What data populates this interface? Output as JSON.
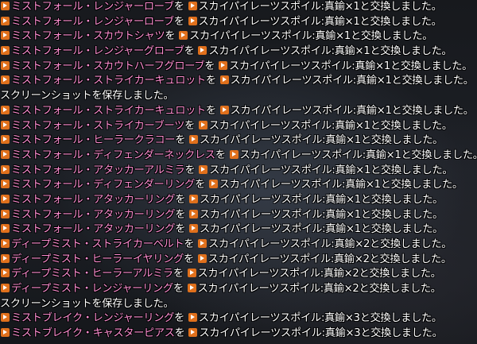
{
  "chat_log": {
    "lines": [
      {
        "item": "ミストフォール・レンジャーローブ",
        "mid": "を",
        "item2": "スカイパイレーツスポイル",
        "rest": ":真鍮×1と交換しました。"
      },
      {
        "item": "ミストフォール・レンジャーローブ",
        "mid": "を",
        "item2": "スカイパイレーツスポイル",
        "rest": ":真鍮×1と交換しました。"
      },
      {
        "item": "ミストフォール・スカウトシャツ",
        "mid": "を",
        "item2": "スカイパイレーツスポイル",
        "rest": ":真鍮×1と交換しました。"
      },
      {
        "item": "ミストフォール・レンジャーグローブ",
        "mid": "を",
        "item2": "スカイパイレーツスポイル",
        "rest": ":真鍮×1と交換しました。"
      },
      {
        "item": "ミストフォール・スカウトハーフグローブ",
        "mid": "を",
        "item2": "スカイパイレーツスポイル",
        "rest": ":真鍮×1と交換しました。"
      },
      {
        "item": "ミストフォール・ストライカーキュロット",
        "mid": "を",
        "item2": "スカイパイレーツスポイル",
        "rest": ":真鍮×1と交換しました。"
      },
      {
        "system": "スクリーンショットを保存しました。"
      },
      {
        "item": "ミストフォール・ストライカーキュロット",
        "mid": "を",
        "item2": "スカイパイレーツスポイル",
        "rest": ":真鍮×1と交換しました。"
      },
      {
        "item": "ミストフォール・ストライカーブーツ",
        "mid": "を",
        "item2": "スカイパイレーツスポイル",
        "rest": ":真鍮×1と交換しました。"
      },
      {
        "item": "ミストフォール・ヒーラークラコー",
        "mid": "を",
        "item2": "スカイパイレーツスポイル",
        "rest": ":真鍮×1と交換しました。"
      },
      {
        "item": "ミストフォール・ディフェンダーネックレス",
        "mid": "を",
        "item2": "スカイパイレーツスポイル",
        "rest": ":真鍮×1と交換しました。"
      },
      {
        "item": "ミストフォール・アタッカーアルミラ",
        "mid": "を",
        "item2": "スカイパイレーツスポイル",
        "rest": ":真鍮×1と交換しました。"
      },
      {
        "item": "ミストフォール・ディフェンダーリング",
        "mid": "を",
        "item2": "スカイパイレーツスポイル",
        "rest": ":真鍮×1と交換しました。"
      },
      {
        "item": "ミストフォール・アタッカーリング",
        "mid": "を",
        "item2": "スカイパイレーツスポイル",
        "rest": ":真鍮×1と交換しました。"
      },
      {
        "item": "ミストフォール・アタッカーリング",
        "mid": "を",
        "item2": "スカイパイレーツスポイル",
        "rest": ":真鍮×1と交換しました。"
      },
      {
        "item": "ミストフォール・アタッカーリング",
        "mid": "を",
        "item2": "スカイパイレーツスポイル",
        "rest": ":真鍮×1と交換しました。"
      },
      {
        "item": "ディープミスト・ストライカーベルト",
        "mid": "を",
        "item2": "スカイパイレーツスポイル",
        "rest": ":真鍮×2と交換しました。"
      },
      {
        "item": "ディープミスト・ヒーラーイヤリング",
        "mid": "を",
        "item2": "スカイパイレーツスポイル",
        "rest": ":真鍮×2と交換しました。"
      },
      {
        "item": "ディープミスト・ヒーラーアルミラ",
        "mid": "を",
        "item2": "スカイパイレーツスポイル",
        "rest": ":真鍮×2と交換しました。"
      },
      {
        "item": "ディープミスト・レンジャーリング",
        "mid": "を",
        "item2": "スカイパイレーツスポイル",
        "rest": ":真鍮×2と交換しました。"
      },
      {
        "system": "スクリーンショットを保存しました。"
      },
      {
        "item": "ミストブレイク・レンジャーリング",
        "mid": "を",
        "item2": "スカイパイレーツスポイル",
        "rest": ":真鍮×3と交換しました。"
      },
      {
        "item": "ミストブレイク・キャスターピアス",
        "mid": "を",
        "item2": "スカイパイレーツスポイル",
        "rest": ":真鍮×3と交換しました。"
      }
    ]
  }
}
